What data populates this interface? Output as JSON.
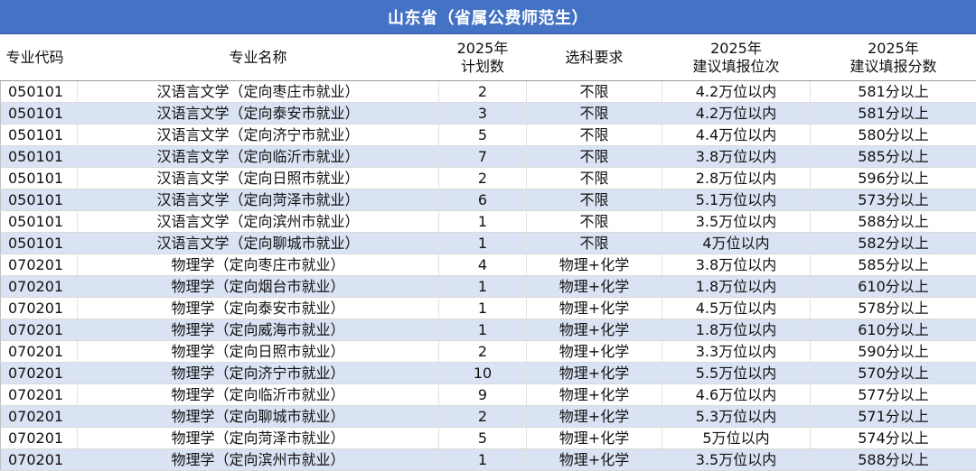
{
  "title": "山东省（省属公费师范生）",
  "headers": {
    "code": "专业代码",
    "name": "专业名称",
    "plan_line1": "2025年",
    "plan_line2": "计划数",
    "subjects": "选科要求",
    "rank_line1": "2025年",
    "rank_line2": "建议填报位次",
    "score_line1": "2025年",
    "score_line2": "建议填报分数"
  },
  "rows": [
    {
      "code": "050101",
      "name": "汉语言文学（定向枣庄市就业）",
      "plan": "2",
      "subjects": "不限",
      "rank": "4.2万位以内",
      "score": "581分以上"
    },
    {
      "code": "050101",
      "name": "汉语言文学（定向泰安市就业）",
      "plan": "3",
      "subjects": "不限",
      "rank": "4.2万位以内",
      "score": "581分以上"
    },
    {
      "code": "050101",
      "name": "汉语言文学（定向济宁市就业）",
      "plan": "5",
      "subjects": "不限",
      "rank": "4.4万位以内",
      "score": "580分以上"
    },
    {
      "code": "050101",
      "name": "汉语言文学（定向临沂市就业）",
      "plan": "7",
      "subjects": "不限",
      "rank": "3.8万位以内",
      "score": "585分以上"
    },
    {
      "code": "050101",
      "name": "汉语言文学（定向日照市就业）",
      "plan": "2",
      "subjects": "不限",
      "rank": "2.8万位以内",
      "score": "596分以上"
    },
    {
      "code": "050101",
      "name": "汉语言文学（定向菏泽市就业）",
      "plan": "6",
      "subjects": "不限",
      "rank": "5.1万位以内",
      "score": "573分以上"
    },
    {
      "code": "050101",
      "name": "汉语言文学（定向滨州市就业）",
      "plan": "1",
      "subjects": "不限",
      "rank": "3.5万位以内",
      "score": "588分以上"
    },
    {
      "code": "050101",
      "name": "汉语言文学（定向聊城市就业）",
      "plan": "1",
      "subjects": "不限",
      "rank": "4万位以内",
      "score": "582分以上"
    },
    {
      "code": "070201",
      "name": "物理学（定向枣庄市就业）",
      "plan": "4",
      "subjects": "物理+化学",
      "rank": "3.8万位以内",
      "score": "585分以上"
    },
    {
      "code": "070201",
      "name": "物理学（定向烟台市就业）",
      "plan": "1",
      "subjects": "物理+化学",
      "rank": "1.8万位以内",
      "score": "610分以上"
    },
    {
      "code": "070201",
      "name": "物理学（定向泰安市就业）",
      "plan": "1",
      "subjects": "物理+化学",
      "rank": "4.5万位以内",
      "score": "578分以上"
    },
    {
      "code": "070201",
      "name": "物理学（定向威海市就业）",
      "plan": "1",
      "subjects": "物理+化学",
      "rank": "1.8万位以内",
      "score": "610分以上"
    },
    {
      "code": "070201",
      "name": "物理学（定向日照市就业）",
      "plan": "2",
      "subjects": "物理+化学",
      "rank": "3.3万位以内",
      "score": "590分以上"
    },
    {
      "code": "070201",
      "name": "物理学（定向济宁市就业）",
      "plan": "10",
      "subjects": "物理+化学",
      "rank": "5.5万位以内",
      "score": "570分以上"
    },
    {
      "code": "070201",
      "name": "物理学（定向临沂市就业）",
      "plan": "9",
      "subjects": "物理+化学",
      "rank": "4.6万位以内",
      "score": "577分以上"
    },
    {
      "code": "070201",
      "name": "物理学（定向聊城市就业）",
      "plan": "2",
      "subjects": "物理+化学",
      "rank": "5.3万位以内",
      "score": "571分以上"
    },
    {
      "code": "070201",
      "name": "物理学（定向菏泽市就业）",
      "plan": "5",
      "subjects": "物理+化学",
      "rank": "5万位以内",
      "score": "574分以上"
    },
    {
      "code": "070201",
      "name": "物理学（定向滨州市就业）",
      "plan": "1",
      "subjects": "物理+化学",
      "rank": "3.5万位以内",
      "score": "588分以上"
    }
  ]
}
